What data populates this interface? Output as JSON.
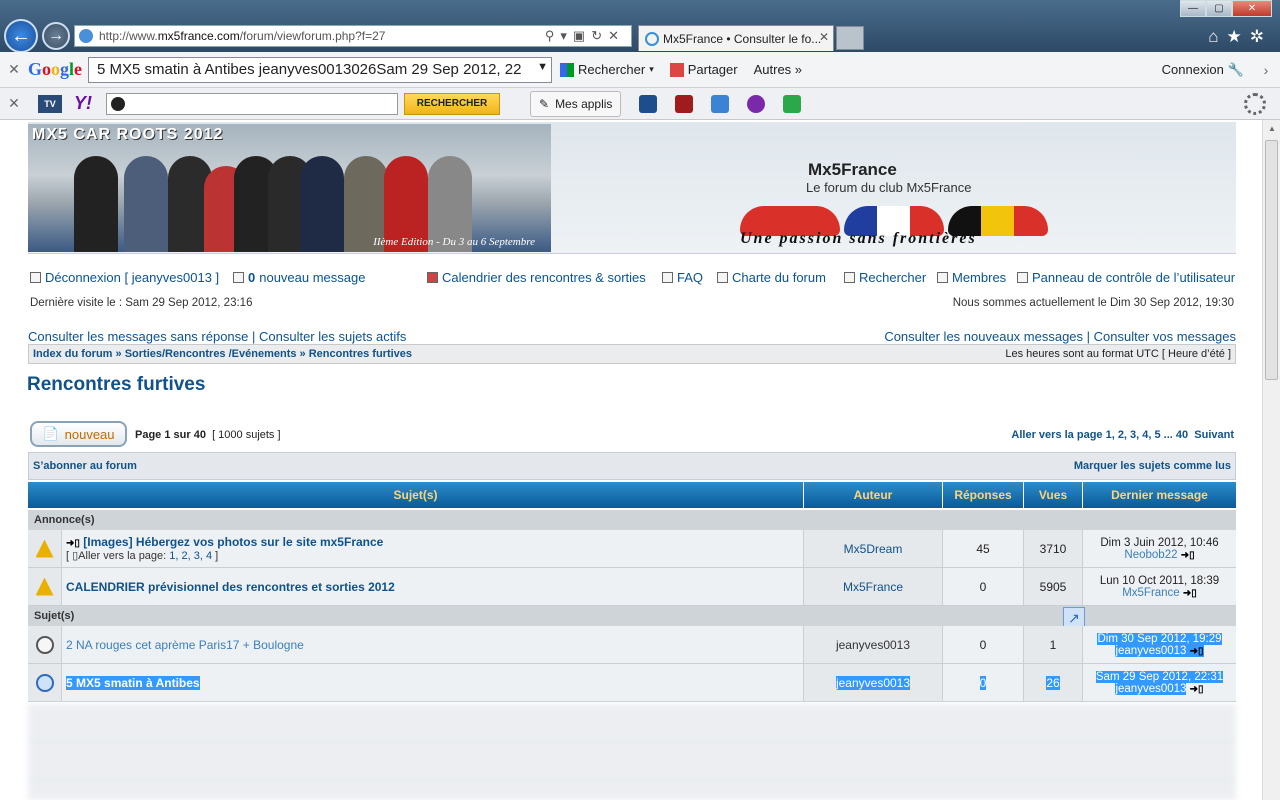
{
  "browser": {
    "address": {
      "prefix": "http://www.",
      "domain": "mx5france.com",
      "path": "/forum/viewforum.php?f=27"
    },
    "tab_title": "Mx5France • Consulter le fo...",
    "window_controls": {
      "min": "—",
      "max": "▢",
      "close": "✕"
    }
  },
  "toolbar_google": {
    "search_text": "5 MX5 smatin à Antibes jeanyves0013026Sam 29 Sep 2012, 22",
    "rechercher": "Rechercher",
    "partager": "Partager",
    "autres": "Autres »",
    "connexion": "Connexion"
  },
  "toolbar_yahoo": {
    "tv": "TV",
    "yahoo": "Y!",
    "search_button": "RECHERCHER",
    "mes_applis": "Mes applis"
  },
  "header": {
    "banner_title": "MX5 CAR ROOTS 2012",
    "banner_caption": "IIème Edition - Du 3 au 6 Septembre",
    "site_title": "Mx5France",
    "site_desc": "Le forum du club Mx5France",
    "slogan": "Une passion sans frontières"
  },
  "nav": {
    "deconnexion": "Déconnexion [ jeanyves0013 ]",
    "msg_count": "0",
    "msg_label": "nouveau message",
    "calendrier": "Calendrier des rencontres & sorties",
    "faq": "FAQ",
    "charte": "Charte du forum",
    "rechercher": "Rechercher",
    "membres": "Membres",
    "panneau": "Panneau de contrôle de l’utilisateur",
    "derniere_visite": "Dernière visite le : Sam 29 Sep 2012, 23:16",
    "maintenant": "Nous sommes actuellement le Dim 30 Sep 2012, 19:30",
    "sans_reponse": "Consulter les messages sans réponse",
    "actifs": "Consulter les sujets actifs",
    "nouveaux": "Consulter les nouveaux messages",
    "vos_messages": "Consulter vos messages"
  },
  "breadcrumb": {
    "index": "Index du forum",
    "sep": " » ",
    "cat": "Sorties/Rencontres /Evénements",
    "current": "Rencontres furtives",
    "timezone": "Les heures sont au format UTC [ Heure d’été ]"
  },
  "forum": {
    "title": "Rencontres furtives",
    "new_button": "nouveau",
    "page_info": "Page 1 sur 40",
    "count": "[ 1000 sujets ]",
    "pagination": "Aller vers la page 1, 2, 3, 4, 5 ... 40",
    "suivant": "Suivant",
    "subscribe": "S’abonner au forum",
    "mark_read": "Marquer les sujets comme lus"
  },
  "table": {
    "headers": [
      "Sujet(s)",
      "Auteur",
      "Réponses",
      "Vues",
      "Dernier message"
    ],
    "section_announce": "Annonce(s)",
    "section_topics": "Sujet(s)",
    "announcements": [
      {
        "title": "[Images] Hébergez vos photos sur le site mx5France",
        "pages_label": "Aller vers la page:",
        "pages": "1, 2, 3, 4",
        "author": "Mx5Dream",
        "replies": "45",
        "views": "3710",
        "last_date": "Dim 3 Juin 2012, 10:46",
        "last_user": "Neobob22"
      },
      {
        "title": "CALENDRIER prévisionnel des rencontres et sorties 2012",
        "author": "Mx5France",
        "replies": "0",
        "views": "5905",
        "last_date": "Lun 10 Oct 2011, 18:39",
        "last_user": "Mx5France"
      }
    ],
    "topics": [
      {
        "title": "2 NA rouges cet aprème Paris17 + Boulogne",
        "author": "jeanyves0013",
        "replies": "0",
        "views": "1",
        "last_date": "Dim 30 Sep 2012, 19:29",
        "last_user": "jeanyves0013"
      },
      {
        "title": "5 MX5 smatin à Antibes",
        "author": "jeanyves0013",
        "replies": "0",
        "views": "26",
        "last_date": "Sam 29 Sep 2012, 22:31",
        "last_user": "jeanyves0013"
      }
    ]
  }
}
